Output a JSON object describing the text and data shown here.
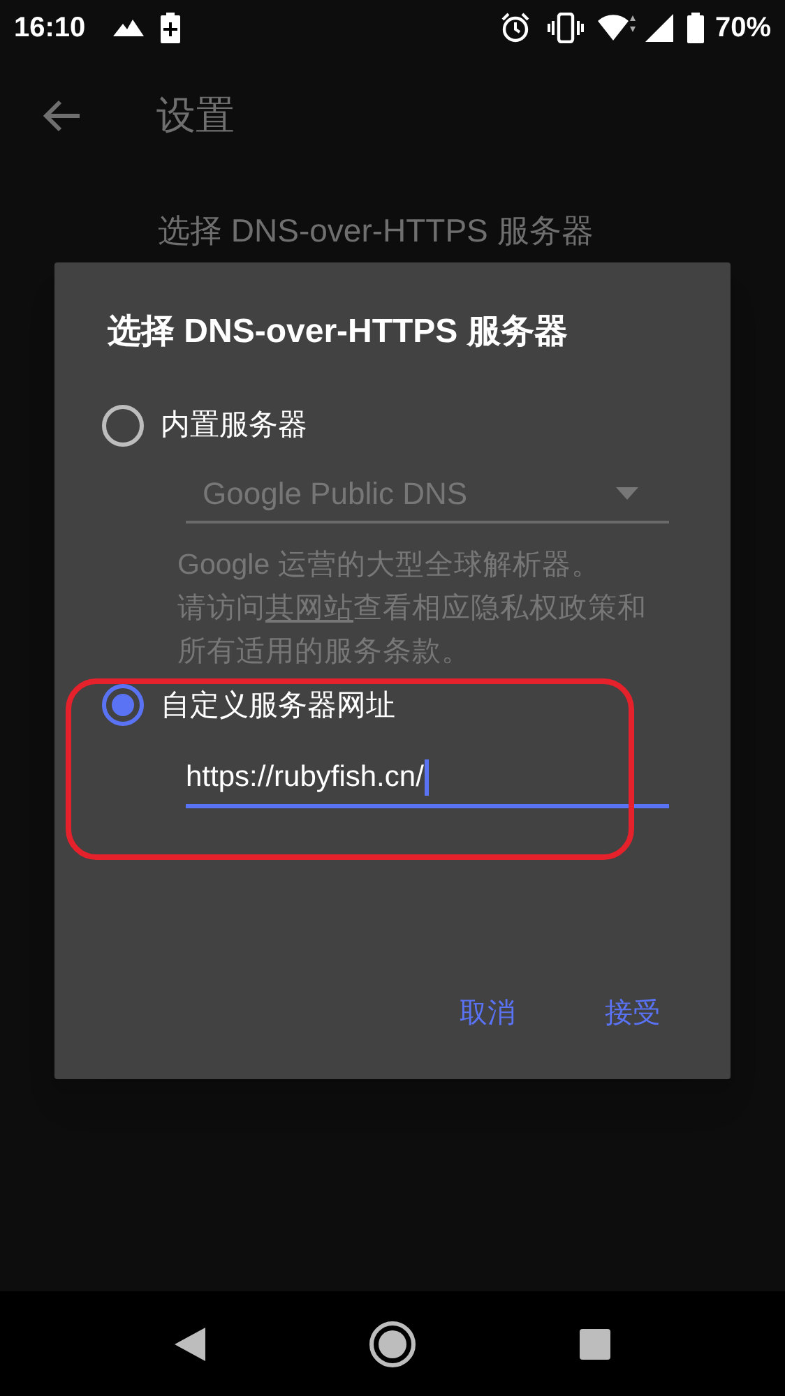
{
  "status_bar": {
    "time": "16:10",
    "battery": "70%"
  },
  "app_bar": {
    "title": "设置"
  },
  "background_item": {
    "title": "选择 DNS-over-HTTPS 服务器"
  },
  "dialog": {
    "title": "选择 DNS-over-HTTPS 服务器",
    "options": [
      {
        "kind": "builtin",
        "label": "内置服务器",
        "selected": false,
        "disabled": true,
        "dropdown": {
          "value": "Google Public DNS"
        },
        "description": {
          "first_line": "Google 运营的大型全球解析器。",
          "before_link": "请访问",
          "link": "其网站",
          "after_link": "查看相应隐私权政策和所有适用的服务条款。"
        }
      },
      {
        "kind": "custom",
        "label": "自定义服务器网址",
        "selected": true,
        "value": "https://rubyfish.cn/"
      }
    ],
    "buttons": [
      "取消",
      "接受"
    ]
  }
}
